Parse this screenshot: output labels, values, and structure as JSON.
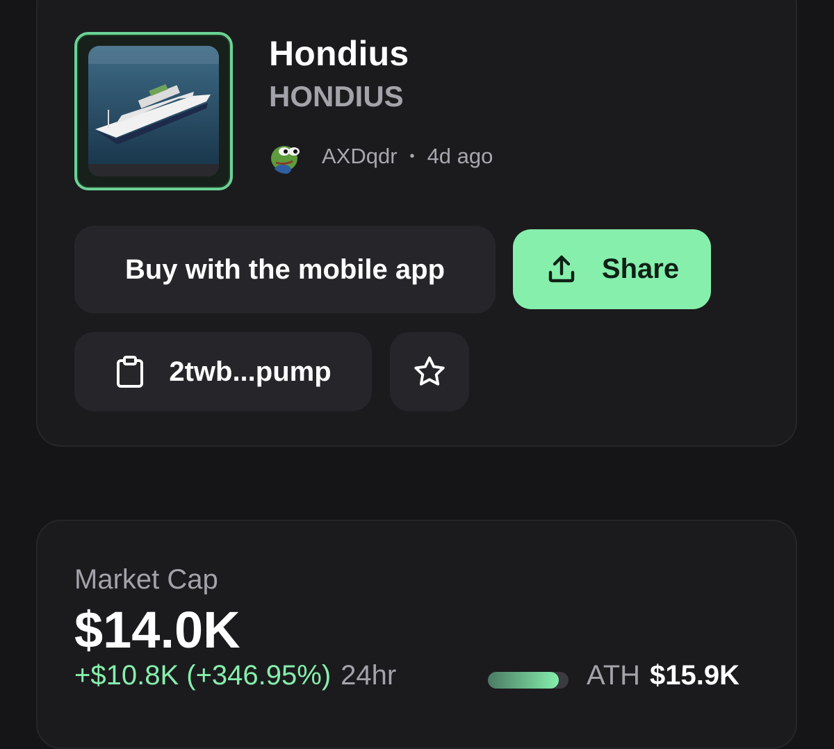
{
  "token": {
    "name": "Hondius",
    "symbol": "HONDIUS",
    "image_icon": "ship-image",
    "creator": {
      "name": "AXDqdr",
      "avatar_icon": "pepe-frog-avatar",
      "age": "4d ago",
      "separator": "•"
    }
  },
  "actions": {
    "buy_label": "Buy with the mobile app",
    "share_label": "Share",
    "share_icon": "upload-share-icon",
    "address_label": "2twb...pump",
    "address_icon": "clipboard-icon",
    "favorite_icon": "star-icon"
  },
  "market": {
    "label": "Market Cap",
    "value": "$14.0K",
    "change": "+$10.8K (+346.95%)",
    "period": "24hr",
    "ath_label": "ATH",
    "ath_value": "$15.9K",
    "ath_progress_percent": 88
  },
  "colors": {
    "background": "#151517",
    "card": "#1b1b1e",
    "button": "#26262a",
    "accent_green": "#86efac",
    "muted_text": "#a3a3aa"
  }
}
